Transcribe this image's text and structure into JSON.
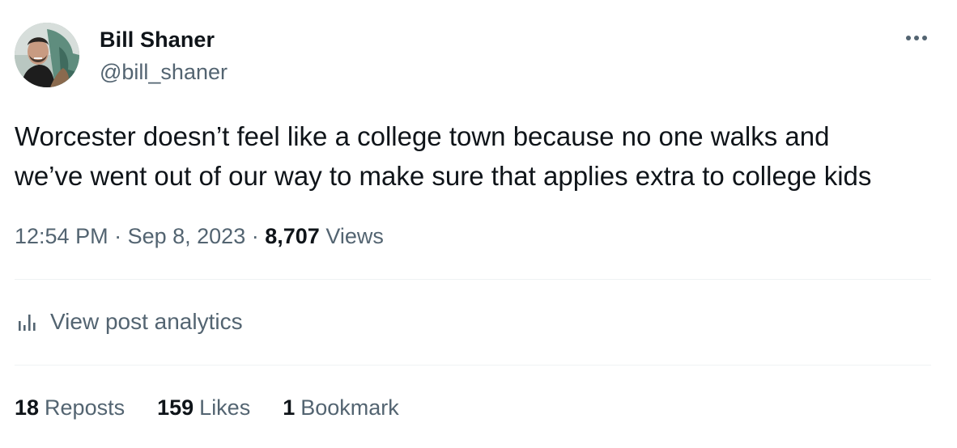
{
  "author": {
    "display_name": "Bill Shaner",
    "handle": "@bill_shaner",
    "avatar_icon": "profile-photo-avatar"
  },
  "tweet": {
    "text": "Worcester doesn’t feel like a college town because no one walks and\nwe’ve went out of our way to make sure that applies extra to college kids"
  },
  "meta": {
    "time": "12:54 PM",
    "separator": " · ",
    "date": "Sep 8, 2023",
    "views_count": "8,707",
    "views_label": "Views"
  },
  "analytics": {
    "icon": "bar-chart-icon",
    "label": "View post analytics"
  },
  "stats": {
    "reposts_count": "18",
    "reposts_label": "Reposts",
    "likes_count": "159",
    "likes_label": "Likes",
    "bookmarks_count": "1",
    "bookmarks_label": "Bookmark"
  },
  "colors": {
    "text_primary": "#0f1419",
    "text_secondary": "#536471",
    "divider": "#eff3f4",
    "background": "#ffffff"
  }
}
